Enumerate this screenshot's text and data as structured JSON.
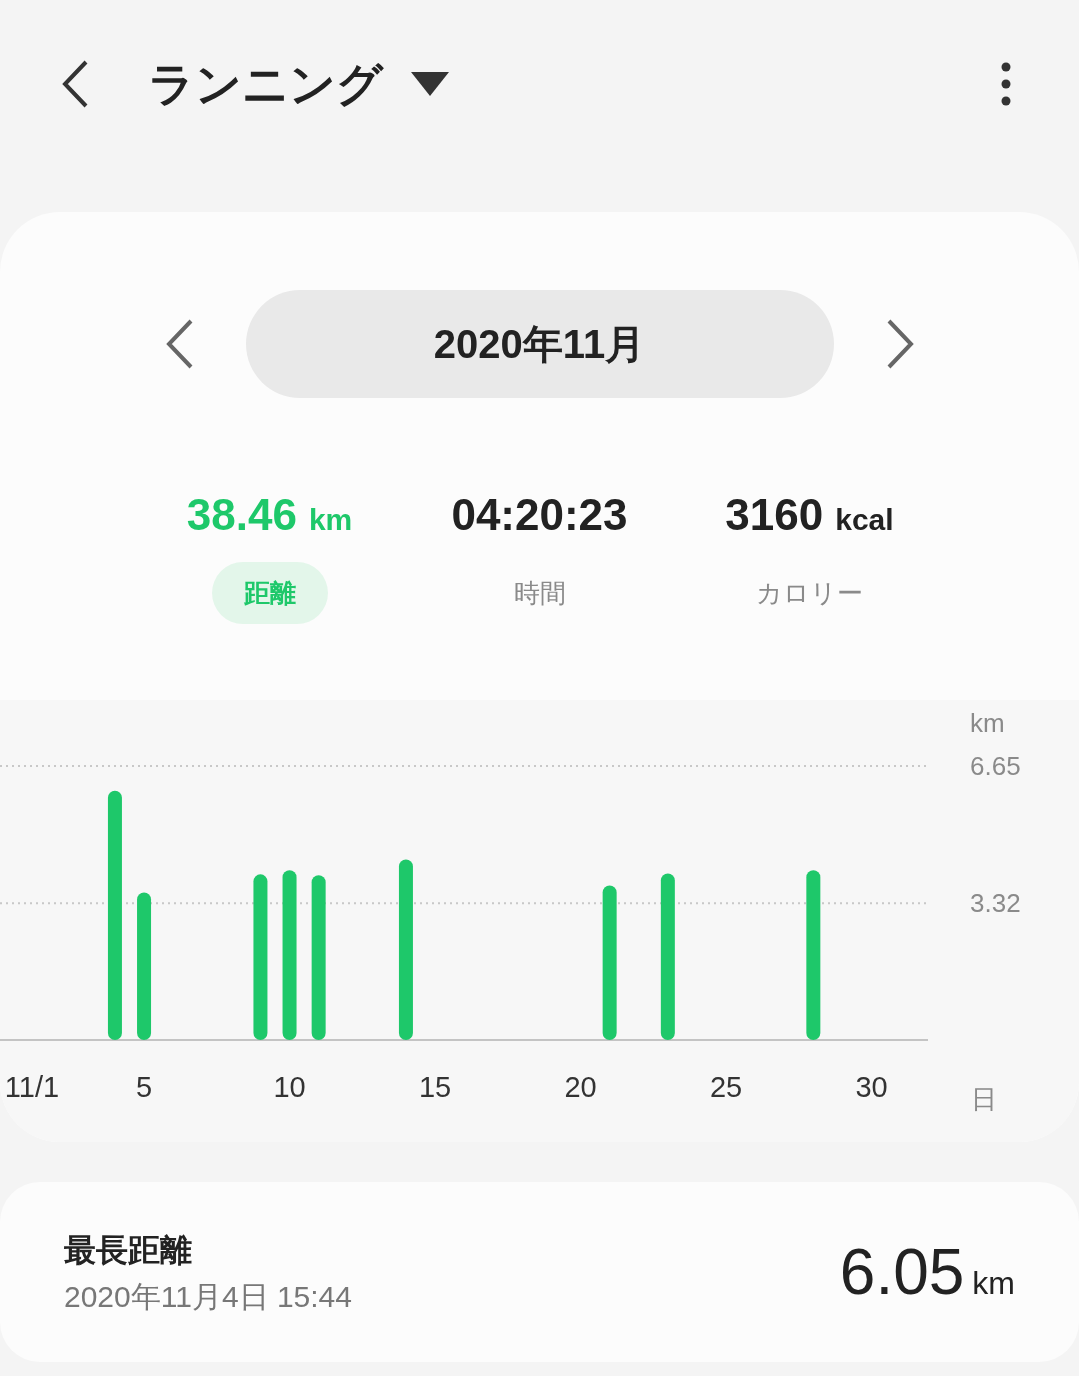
{
  "header": {
    "title": "ランニング"
  },
  "period": {
    "label": "2020年11月"
  },
  "stats": [
    {
      "value": "38.46",
      "unit": "km",
      "label": "距離",
      "selected": true
    },
    {
      "value": "04:20:23",
      "label": "時間",
      "selected": false
    },
    {
      "value": "3160",
      "unit": "kcal",
      "label": "カロリー",
      "selected": false
    }
  ],
  "chart": {
    "y_unit": "km",
    "x_unit": "日",
    "chart_data": {
      "type": "bar",
      "x": [
        4,
        5,
        9,
        10,
        11,
        14,
        21,
        23,
        28
      ],
      "series": [
        {
          "color": "#1ec86a",
          "values": [
            6.05,
            3.58,
            4.02,
            4.12,
            4.0,
            4.38,
            3.75,
            4.04,
            4.12
          ]
        }
      ],
      "xlim": [
        0.05,
        31.94
      ],
      "xticks": [
        {
          "value": 1,
          "label": "11/1"
        },
        {
          "value": 5,
          "label": "5"
        },
        {
          "value": 10,
          "label": "10"
        },
        {
          "value": 15,
          "label": "15"
        },
        {
          "value": 20,
          "label": "20"
        },
        {
          "value": 25,
          "label": "25"
        },
        {
          "value": 30,
          "label": "30"
        }
      ],
      "ylim": [
        0,
        6.65
      ],
      "yticks": [
        {
          "value": 3.32,
          "label": "3.32"
        },
        {
          "value": 6.65,
          "label": "6.65"
        }
      ]
    }
  },
  "longest": {
    "label": "最長距離",
    "datetime": "2020年11月4日 15:44",
    "value": "6.05",
    "unit": "km"
  }
}
